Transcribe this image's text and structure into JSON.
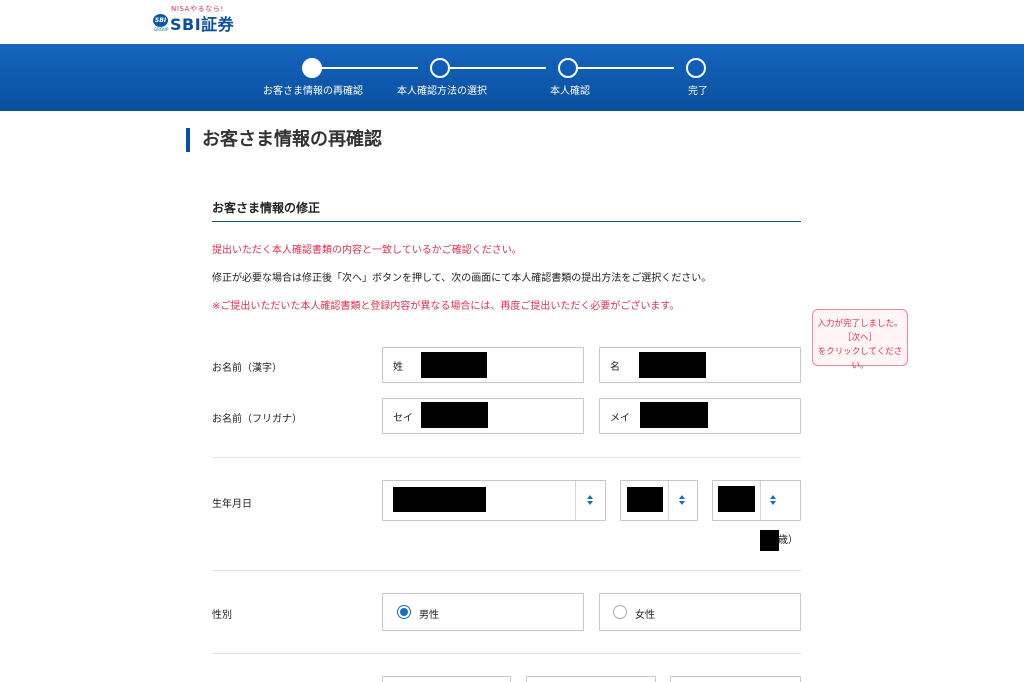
{
  "brand": {
    "tagline": "NISAやるなら!",
    "badge": "SBI",
    "badge_sub": "GROUP",
    "name": "SBI証券"
  },
  "steps": [
    {
      "label": "お客さま情報の再確認",
      "active": true
    },
    {
      "label": "本人確認方法の選択",
      "active": false
    },
    {
      "label": "本人確認",
      "active": false
    },
    {
      "label": "完了",
      "active": false
    }
  ],
  "page_title": "お客さま情報の再確認",
  "section": {
    "title": "お客さま情報の修正",
    "msg_check": "提出いただく本人確認書類の内容と一致しているかご確認ください。",
    "msg_instruction": "修正が必要な場合は修正後「次へ」ボタンを押して、次の画面にて本人確認書類の提出方法をご選択ください。",
    "msg_note": "※ご提出いただいた本人確認書類と登録内容が異なる場合には、再度ご提出いただく必要がございます。"
  },
  "tooltip": {
    "line1": "入力が完了しました。",
    "line2": "［次へ］",
    "line3": "をクリックしてください。"
  },
  "form": {
    "name_kanji": {
      "label": "お名前（漢字）",
      "last_prefix": "姓",
      "first_prefix": "名"
    },
    "name_kana": {
      "label": "お名前（フリガナ）",
      "last_prefix": "セイ",
      "first_prefix": "メイ"
    },
    "birthdate": {
      "label": "生年月日",
      "age_suffix": "歳）"
    },
    "gender": {
      "label": "性別",
      "options": [
        "男性",
        "女性"
      ],
      "selected": "男性"
    }
  },
  "colors": {
    "brand_blue": "#0b4ea2",
    "accent_red": "#e0304f",
    "radio_blue": "#1a6cc4"
  }
}
